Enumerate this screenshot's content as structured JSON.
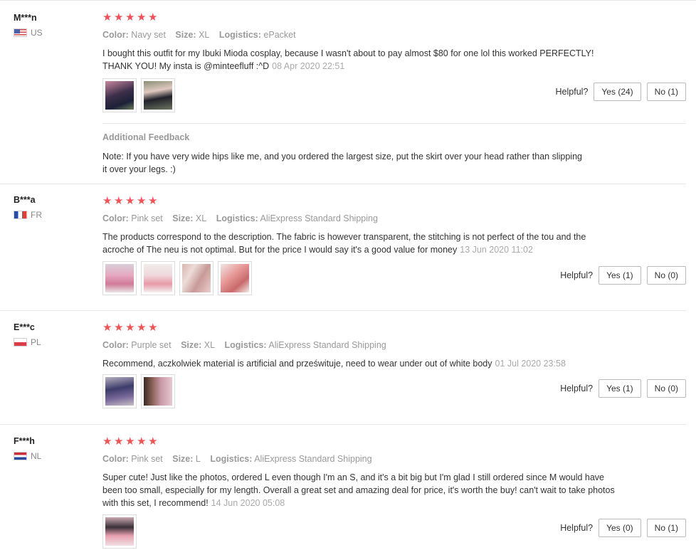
{
  "labels": {
    "color": "Color:",
    "size": "Size:",
    "logistics": "Logistics:",
    "helpful": "Helpful?",
    "additional_feedback": "Additional Feedback"
  },
  "reviews": [
    {
      "user": "M***n",
      "country": "US",
      "stars": 5,
      "color": "Navy set",
      "size": "XL",
      "logistics": "ePacket",
      "text": "I bought this outfit for my Ibuki Mioda cosplay, because I wasn't about to pay almost $80 for one lol this worked PERFECTLY! THANK YOU! My insta is @minteefluff :^D",
      "date": "08 Apr 2020 22:51",
      "yes": "Yes (24)",
      "no": "No (1)",
      "photos": [
        "photo-1",
        "photo-2"
      ],
      "additional_feedback": "Note: If you have very wide hips like me, and you ordered the largest size, put the skirt over your head rather than slipping it over your legs. :)"
    },
    {
      "user": "B***a",
      "country": "FR",
      "stars": 5,
      "color": "Pink set",
      "size": "XL",
      "logistics": "AliExpress Standard Shipping",
      "text": "The products correspond to the description. The fabric is however transparent, the stitching is not perfect of the tou and the acroche of The neu is not optimal. But for the price I would say it's a good value for money",
      "date": "13 Jun 2020 11:02",
      "yes": "Yes (1)",
      "no": "No (0)",
      "photos": [
        "photo-1",
        "photo-2",
        "photo-3",
        "photo-4"
      ]
    },
    {
      "user": "E***c",
      "country": "PL",
      "stars": 5,
      "color": "Purple set",
      "size": "XL",
      "logistics": "AliExpress Standard Shipping",
      "text": "Recommend, aczkolwiek material is artificial and prześwituje, need to wear under out of white body",
      "date": "01 Jul 2020 23:58",
      "yes": "Yes (1)",
      "no": "No (0)",
      "photos": [
        "photo-1",
        "photo-2"
      ]
    },
    {
      "user": "F***h",
      "country": "NL",
      "stars": 5,
      "color": "Pink set",
      "size": "L",
      "logistics": "AliExpress Standard Shipping",
      "text": "Super cute! Just like the photos, ordered L even though I'm an S, and it's a bit big but I'm glad I still ordered since M would have been too small, especially for my length. Overall a great set and amazing deal for price, it's worth the buy! can't wait to take photos with this set, I recommend!",
      "date": "14 Jun 2020 05:08",
      "yes": "Yes (0)",
      "no": "No (1)",
      "photos": [
        "photo-1"
      ]
    }
  ],
  "colors": {
    "star": "#f25157",
    "muted": "#999999",
    "border": "#e8e8e8"
  }
}
